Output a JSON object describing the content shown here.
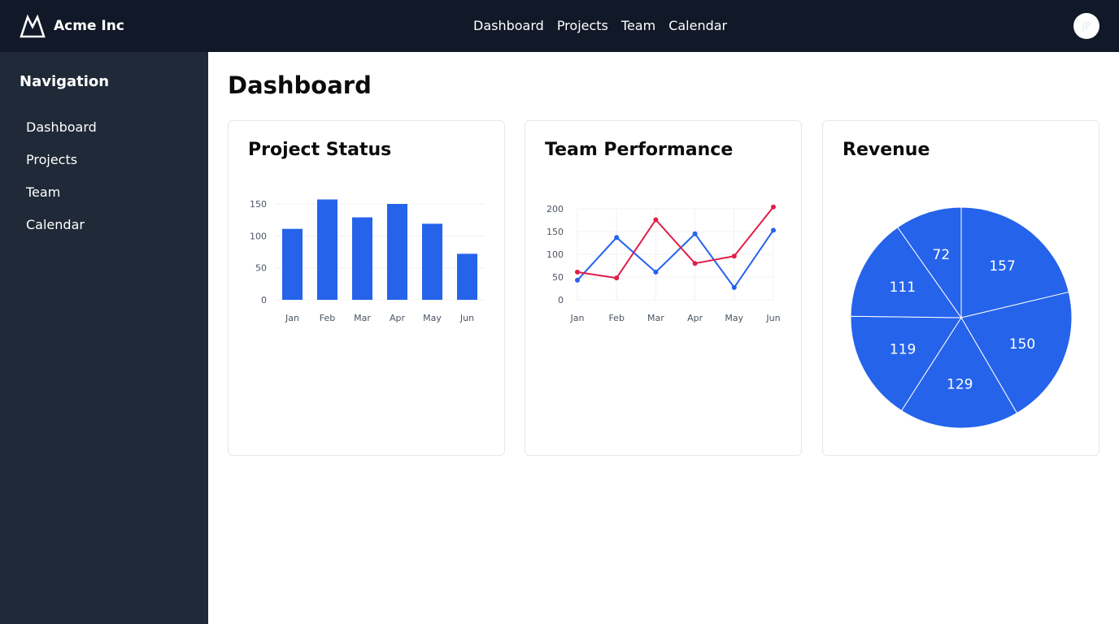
{
  "header": {
    "brand_name": "Acme Inc",
    "nav": [
      "Dashboard",
      "Projects",
      "Team",
      "Calendar"
    ],
    "avatar_initials": "JP",
    "bg_color": "#111827"
  },
  "sidebar": {
    "title": "Navigation",
    "items": [
      "Dashboard",
      "Projects",
      "Team",
      "Calendar"
    ],
    "bg_color": "#1f2937"
  },
  "main": {
    "title": "Dashboard",
    "cards": [
      {
        "title": "Project Status"
      },
      {
        "title": "Team Performance"
      },
      {
        "title": "Revenue"
      }
    ]
  },
  "chart_data": [
    {
      "type": "bar",
      "title": "Project Status",
      "categories": [
        "Jan",
        "Feb",
        "Mar",
        "Apr",
        "May",
        "Jun"
      ],
      "values": [
        111,
        157,
        129,
        150,
        119,
        72
      ],
      "ylim": [
        0,
        150
      ],
      "yticks": [
        0,
        50,
        100,
        150
      ],
      "color": "#2563eb",
      "grid": true
    },
    {
      "type": "line",
      "title": "Team Performance",
      "categories": [
        "Jan",
        "Feb",
        "Mar",
        "Apr",
        "May",
        "Jun"
      ],
      "series": [
        {
          "values": [
            43,
            137,
            61,
            145,
            27,
            153
          ],
          "color": "#2563eb"
        },
        {
          "values": [
            61,
            48,
            176,
            80,
            96,
            204
          ],
          "color": "#e11d48"
        }
      ],
      "ylim": [
        0,
        200
      ],
      "yticks": [
        0,
        50,
        100,
        150,
        200
      ],
      "grid": true
    },
    {
      "type": "pie",
      "title": "Revenue",
      "values": [
        157,
        150,
        129,
        119,
        111,
        72
      ],
      "color": "#2563eb"
    }
  ]
}
